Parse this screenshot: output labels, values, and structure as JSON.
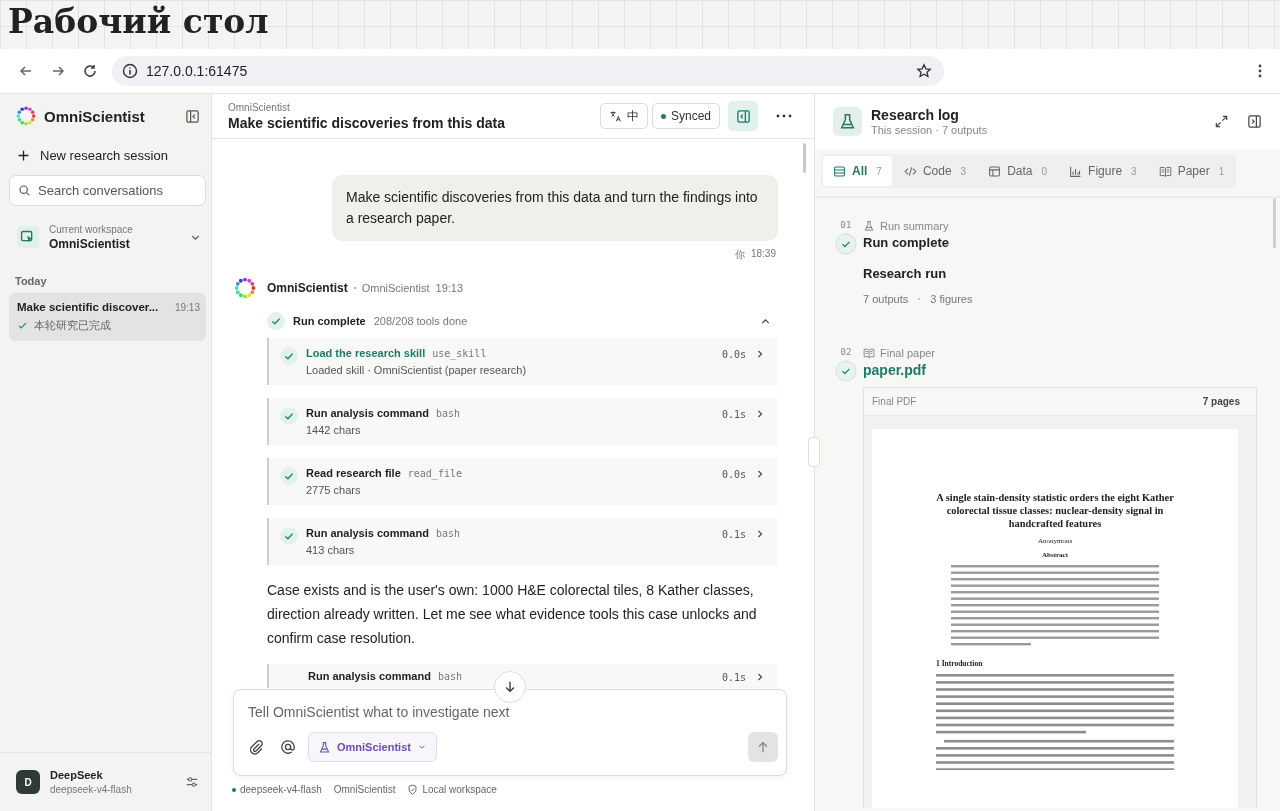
{
  "desktop_caption": "Рабочий стол",
  "browser": {
    "url": "127.0.0.1:61475"
  },
  "sidebar": {
    "brand": "OmniScientist",
    "new_session": "New research session",
    "search_placeholder": "Search conversations",
    "workspace": {
      "label": "Current workspace",
      "name": "OmniScientist"
    },
    "section": "Today",
    "conversations": [
      {
        "title": "Make scientific discover...",
        "time": "19:13",
        "status": "本轮研究已完成",
        "selected": true
      }
    ],
    "user": {
      "initial": "D",
      "name": "DeepSeek",
      "model": "deepseek-v4-flash"
    }
  },
  "chat": {
    "breadcrumb": "OmniScientist",
    "title": "Make scientific discoveries from this data",
    "lang_button": "中",
    "sync_status": "Synced",
    "user_message": {
      "text": "Make scientific discoveries from this data and turn the findings into a research paper.",
      "sender": "你",
      "time": "18:39"
    },
    "assistant": {
      "name": "OmniScientist",
      "agent": "OmniScientist",
      "time": "19:13",
      "run": {
        "label": "Run complete",
        "summary": "208/208 tools done",
        "expanded": true
      },
      "tools": [
        {
          "kind": "skill",
          "title": "Load the research skill",
          "command": "use_skill",
          "detail": "Loaded skill · OmniScientist (paper research)",
          "duration": "0.0s"
        },
        {
          "kind": "command",
          "title": "Run analysis command",
          "command": "bash",
          "detail": "1442 chars",
          "duration": "0.1s"
        },
        {
          "kind": "command",
          "title": "Read research file",
          "command": "read_file",
          "detail": "2775 chars",
          "duration": "0.0s"
        },
        {
          "kind": "command",
          "title": "Run analysis command",
          "command": "bash",
          "detail": "413 chars",
          "duration": "0.1s"
        }
      ],
      "message": "Case exists and is the user's own: 1000 H&E colorectal tiles, 8 Kather classes, direction already written. Let me see what evidence tools this case unlocks and confirm case resolution.",
      "partial_tool": {
        "title": "Run analysis command",
        "command": "bash",
        "duration": "0.1s"
      }
    },
    "composer": {
      "placeholder": "Tell OmniScientist what to investigate next",
      "agent": "OmniScientist"
    },
    "footer": [
      {
        "kind": "model",
        "text": "deepseek-v4-flash"
      },
      {
        "kind": "plain",
        "text": "OmniScientist"
      },
      {
        "kind": "shield",
        "text": "Local workspace"
      }
    ]
  },
  "research_log": {
    "title": "Research log",
    "subtitle": "This session · 7 outputs",
    "tabs": [
      {
        "kind": "all",
        "label": "All",
        "count": "7",
        "selected": true
      },
      {
        "kind": "code",
        "label": "Code",
        "count": "3",
        "selected": false
      },
      {
        "kind": "data",
        "label": "Data",
        "count": "0",
        "selected": false
      },
      {
        "kind": "figure",
        "label": "Figure",
        "count": "3",
        "selected": false
      },
      {
        "kind": "paper",
        "label": "Paper",
        "count": "1",
        "selected": false
      }
    ],
    "entries": [
      {
        "kind": "summary",
        "number": "01",
        "category": "Run summary",
        "title": "Run complete",
        "heading": "Research run",
        "stats": [
          "7 outputs",
          "3 figures"
        ]
      },
      {
        "kind": "paper",
        "number": "02",
        "category": "Final paper",
        "title": "paper.pdf",
        "preview": {
          "label": "Final PDF",
          "pages": "7 pages",
          "document": {
            "title": "A single stain-density statistic orders the eight Kather colorectal tissue classes: nuclear-density signal in handcrafted features",
            "author": "Anonymous",
            "abstract_heading": "Abstract",
            "section_heading": "1 Introduction"
          }
        }
      }
    ]
  }
}
